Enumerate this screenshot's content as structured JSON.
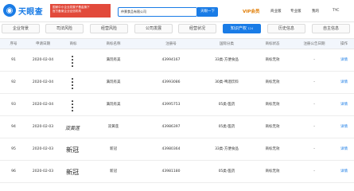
{
  "header": {
    "logo_text": "天眼查",
    "banner_line1": "国家中小企业发展子基金旗下",
    "banner_line2": "官方备案企业征信机构",
    "search_value": "仲景食品有限公司",
    "search_button": "天眼一下",
    "vip_label": "VIP会员",
    "nav_items": [
      "商业版",
      "专业版",
      "我的",
      "TYC"
    ]
  },
  "tabs": [
    {
      "label": "企业背景",
      "count": ""
    },
    {
      "label": "司法风险",
      "count": ""
    },
    {
      "label": "经营风险",
      "count": ""
    },
    {
      "label": "公司发展",
      "count": ""
    },
    {
      "label": "经营状况",
      "count": ""
    },
    {
      "label": "知识产权",
      "count": "124",
      "active": true
    },
    {
      "label": "历史信息",
      "count": ""
    },
    {
      "label": "自主信息",
      "count": ""
    }
  ],
  "table": {
    "columns": [
      "序号",
      "申请日期",
      "商标",
      "商标名称",
      "注册号",
      "国际分类",
      "商标状态",
      "注册公告日期",
      "操作"
    ],
    "rows": [
      {
        "index": "91",
        "date": "2020-02-04",
        "mark_text": "",
        "name": "满玩有美",
        "reg": "43994167",
        "class": "33类-方便食品",
        "status": "商标无效",
        "pub_date": "-",
        "op": "详情"
      },
      {
        "index": "92",
        "date": "2020-02-04",
        "mark_text": "",
        "name": "满玩有美",
        "reg": "43993086",
        "class": "30类-啤酒饮料",
        "status": "商标无效",
        "pub_date": "-",
        "op": "详情"
      },
      {
        "index": "93",
        "date": "2020-02-04",
        "mark_text": "",
        "name": "满玩有美",
        "reg": "43995753",
        "class": "05类-医药",
        "status": "商标无效",
        "pub_date": "-",
        "op": "详情"
      },
      {
        "index": "94",
        "date": "2020-02-03",
        "mark_text": "双黄莲",
        "name": "双黄莲",
        "reg": "43986397",
        "class": "05类-医药",
        "status": "商标无效",
        "pub_date": "-",
        "op": "详情"
      },
      {
        "index": "95",
        "date": "2020-02-03",
        "mark_text": "新冠",
        "name": "新冠",
        "reg": "43980364",
        "class": "33类-方便食品",
        "status": "商标无效",
        "pub_date": "-",
        "op": "详情"
      },
      {
        "index": "96",
        "date": "2020-02-03",
        "mark_text": "新冠",
        "name": "新冠",
        "reg": "43981180",
        "class": "05类-医药",
        "status": "商标无效",
        "pub_date": "-",
        "op": "详情"
      }
    ]
  }
}
